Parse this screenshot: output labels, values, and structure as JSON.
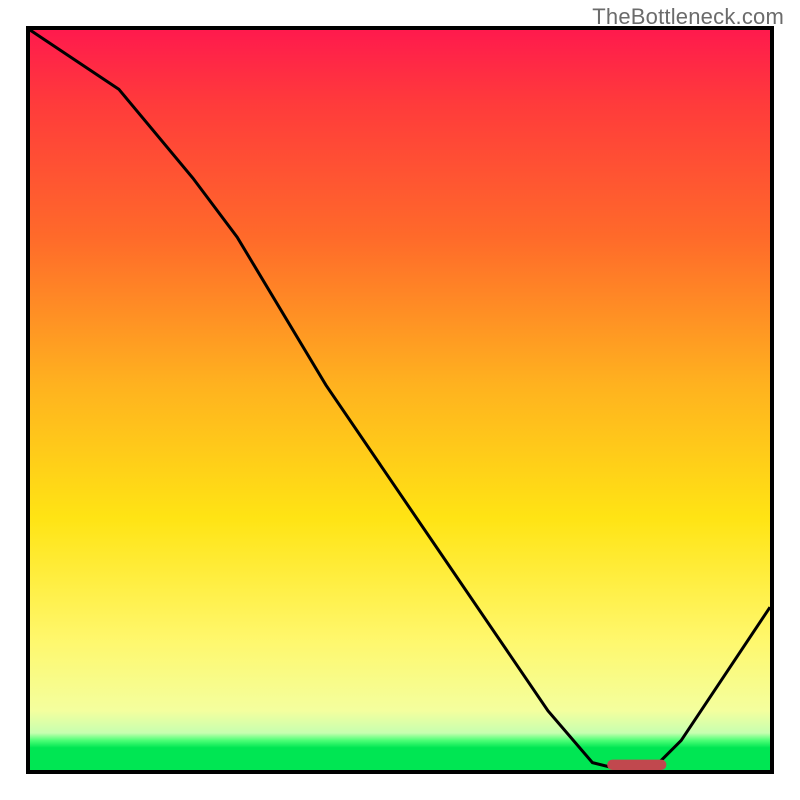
{
  "header": {
    "watermark": "TheBottleneck.com"
  },
  "chart_data": {
    "type": "line",
    "title": "",
    "xlabel": "",
    "ylabel": "",
    "xlim": [
      0,
      100
    ],
    "ylim": [
      0,
      100
    ],
    "series": [
      {
        "name": "bottleneck-curve",
        "x": [
          0,
          12,
          22,
          28,
          40,
          55,
          70,
          76,
          80,
          84,
          88,
          100
        ],
        "values": [
          100,
          92,
          80,
          72,
          52,
          30,
          8,
          1,
          0,
          0,
          4,
          22
        ]
      }
    ],
    "marker": {
      "name": "optimal-range",
      "x_start": 78,
      "x_end": 86,
      "y": 0
    },
    "gradient_stops_percent_from_top": {
      "red": 0,
      "orange": 40,
      "yellow": 70,
      "pale": 92,
      "green": 97
    },
    "colors": {
      "curve": "#000000",
      "marker": "#c1484e",
      "frame": "#000000",
      "watermark": "#6b6b6b"
    }
  }
}
